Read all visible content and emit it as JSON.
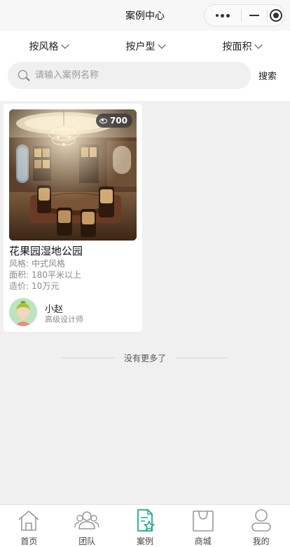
{
  "header": {
    "title": "案例中心"
  },
  "filters": [
    {
      "label": "按风格"
    },
    {
      "label": "按户型"
    },
    {
      "label": "按面积"
    }
  ],
  "search": {
    "placeholder": "请输入案例名称",
    "value": "",
    "button_label": "搜索"
  },
  "cases": [
    {
      "title": "花果园湿地公园",
      "views": "700",
      "style_label": "风格:",
      "style_value": "中式风格",
      "area_label": "面积:",
      "area_value": "180平米以上",
      "cost_label": "造价:",
      "cost_value": "10万元",
      "designer_name": "小赵",
      "designer_title": "高级设计师"
    }
  ],
  "footer_note": "没有更多了",
  "tabbar": {
    "active_color": "#1aab8a",
    "inactive_color": "#999999",
    "items": [
      {
        "label": "首页",
        "icon": "home-icon"
      },
      {
        "label": "团队",
        "icon": "team-icon"
      },
      {
        "label": "案例",
        "icon": "case-icon",
        "active": true
      },
      {
        "label": "商城",
        "icon": "shop-icon"
      },
      {
        "label": "我的",
        "icon": "profile-icon"
      }
    ]
  }
}
